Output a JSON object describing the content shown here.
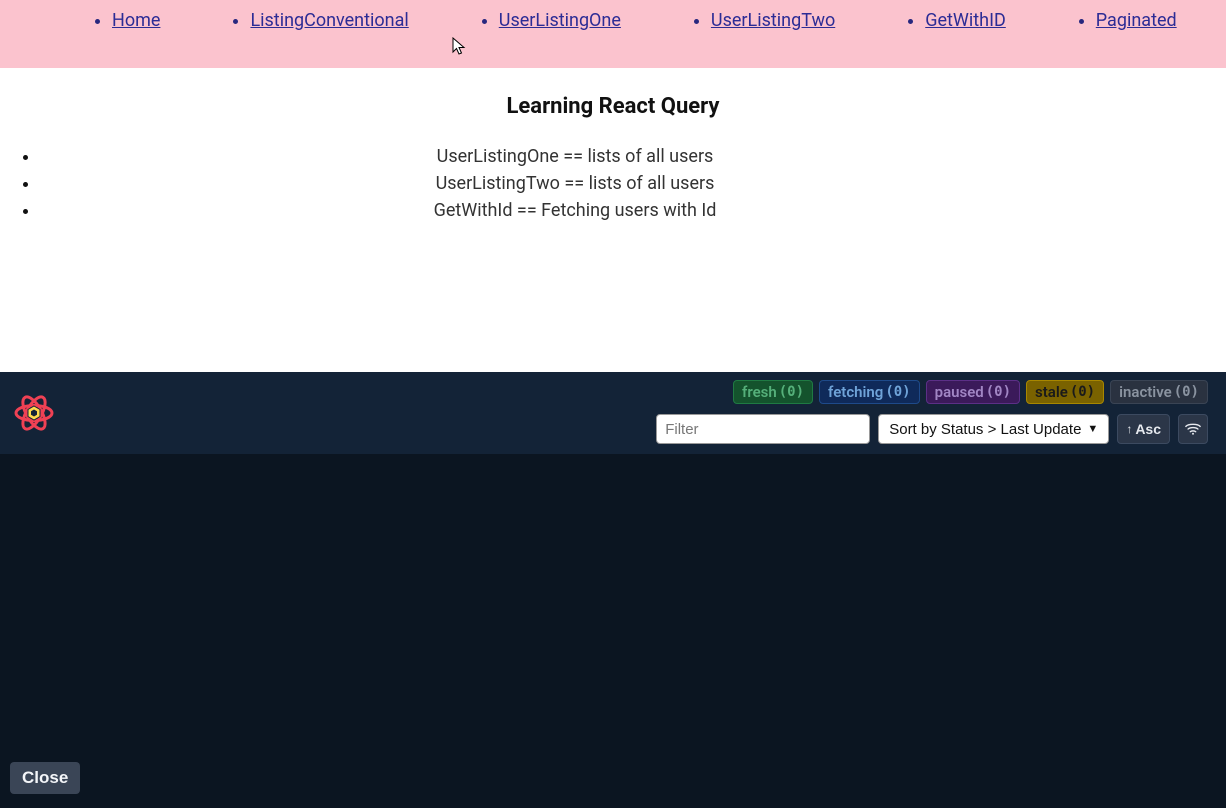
{
  "nav": {
    "items": [
      {
        "label": "Home"
      },
      {
        "label": "ListingConventional"
      },
      {
        "label": "UserListingOne"
      },
      {
        "label": "UserListingTwo"
      },
      {
        "label": "GetWithID"
      },
      {
        "label": "Paginated"
      }
    ]
  },
  "page": {
    "title": "Learning React Query",
    "descriptions": [
      "UserListingOne == lists of all users",
      "UserListingTwo == lists of all users",
      "GetWithId == Fetching users with Id"
    ]
  },
  "devtools": {
    "status": {
      "fresh": {
        "label": "fresh",
        "count": "(0)"
      },
      "fetching": {
        "label": "fetching",
        "count": "(0)"
      },
      "paused": {
        "label": "paused",
        "count": "(0)"
      },
      "stale": {
        "label": "stale",
        "count": "(0)"
      },
      "inactive": {
        "label": "inactive",
        "count": "(0)"
      }
    },
    "filter_placeholder": "Filter",
    "sort_label": "Sort by Status > Last Update",
    "asc_label": "Asc",
    "close_label": "Close"
  },
  "icons": {
    "react_query_logo": "react-query-logo-icon",
    "caret_down": "caret-down-icon",
    "arrow_up": "arrow-up-icon",
    "wifi": "wifi-icon",
    "cursor": "cursor-icon"
  },
  "colors": {
    "nav_bg": "#fbc3ce",
    "link": "#2c2c95",
    "devtools_header": "#132337",
    "devtools_body": "#0b1521"
  }
}
